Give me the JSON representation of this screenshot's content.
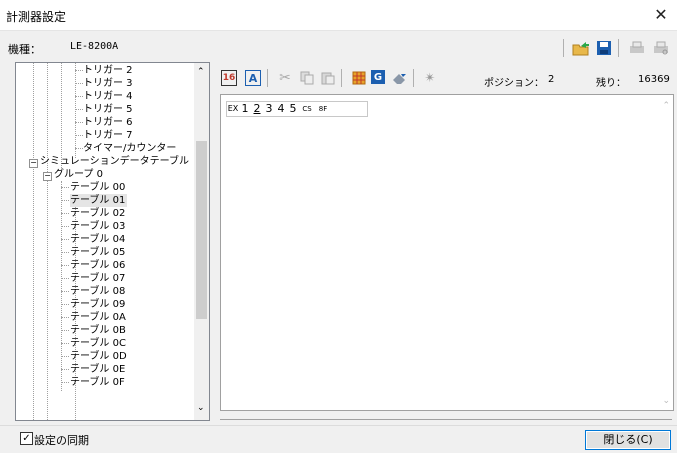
{
  "window": {
    "title": "計測器設定",
    "close_symbol": "✕"
  },
  "model": {
    "label": "機種：",
    "value": "LE-8200A"
  },
  "toolbar": {
    "icons": [
      "export-folder-icon",
      "save-icon",
      "print-icon",
      "print-preview-icon",
      "hex-16-icon",
      "ascii-a-icon",
      "cut-icon",
      "copy-icon",
      "paste-icon",
      "grid-icon",
      "g-icon",
      "eraser-icon",
      "spinner-icon"
    ],
    "position_label": "ポジション：",
    "position_value": "2",
    "remaining_label": "残り：",
    "remaining_value": "16369",
    "hex16_text": "16",
    "ascii_text": "A",
    "g_text": "G"
  },
  "tree": {
    "triggers": [
      "トリガー 2",
      "トリガー 3",
      "トリガー 4",
      "トリガー 5",
      "トリガー 6",
      "トリガー 7"
    ],
    "timer_counter": "タイマー/カウンター",
    "sim_table": "シミュレーションデータテーブル",
    "group0": "グループ 0",
    "tables": [
      "テーブル 00",
      "テーブル 01",
      "テーブル 02",
      "テーブル 03",
      "テーブル 04",
      "テーブル 05",
      "テーブル 06",
      "テーブル 07",
      "テーブル 08",
      "テーブル 09",
      "テーブル 0A",
      "テーブル 0B",
      "テーブル 0C",
      "テーブル 0D",
      "テーブル 0E",
      "テーブル 0F"
    ],
    "selected_index": 1
  },
  "data_chips": [
    "EX",
    "1",
    "2",
    "3",
    "4",
    "5",
    "CS",
    "8F"
  ],
  "footer": {
    "sync_checked": "☑",
    "sync_label": "設定の同期",
    "close_button": "閉じる(C)"
  },
  "colors": {
    "accent": "#0078d7",
    "selection": "#cde8ff"
  }
}
